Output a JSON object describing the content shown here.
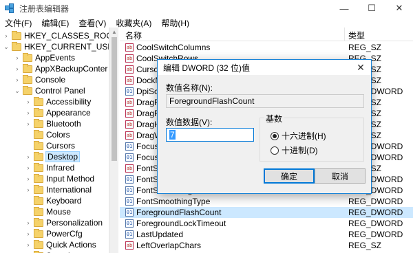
{
  "window": {
    "title": "注册表编辑器",
    "minimize": "—",
    "maximize": "☐",
    "close": "✕"
  },
  "menu": [
    "文件(F)",
    "编辑(E)",
    "查看(V)",
    "收藏夹(A)",
    "帮助(H)"
  ],
  "tree": [
    {
      "label": "HKEY_CLASSES_ROOT",
      "expander": "›",
      "indent": 0
    },
    {
      "label": "HKEY_CURRENT_USER",
      "expander": "⌄",
      "indent": 0
    },
    {
      "label": "AppEvents",
      "expander": "›",
      "indent": 1
    },
    {
      "label": "AppXBackupConter",
      "expander": "›",
      "indent": 1
    },
    {
      "label": "Console",
      "expander": "›",
      "indent": 1
    },
    {
      "label": "Control Panel",
      "expander": "⌄",
      "indent": 1
    },
    {
      "label": "Accessibility",
      "expander": "›",
      "indent": 2
    },
    {
      "label": "Appearance",
      "expander": "›",
      "indent": 2
    },
    {
      "label": "Bluetooth",
      "expander": "›",
      "indent": 2
    },
    {
      "label": "Colors",
      "expander": "",
      "indent": 2
    },
    {
      "label": "Cursors",
      "expander": "",
      "indent": 2
    },
    {
      "label": "Desktop",
      "expander": "›",
      "indent": 2,
      "selected": true
    },
    {
      "label": "Infrared",
      "expander": "›",
      "indent": 2
    },
    {
      "label": "Input Method",
      "expander": "›",
      "indent": 2
    },
    {
      "label": "International",
      "expander": "›",
      "indent": 2
    },
    {
      "label": "Keyboard",
      "expander": "",
      "indent": 2
    },
    {
      "label": "Mouse",
      "expander": "",
      "indent": 2
    },
    {
      "label": "Personalization",
      "expander": "›",
      "indent": 2
    },
    {
      "label": "PowerCfg",
      "expander": "›",
      "indent": 2
    },
    {
      "label": "Quick Actions",
      "expander": "›",
      "indent": 2
    },
    {
      "label": "Sound",
      "expander": "›",
      "indent": 2
    }
  ],
  "list": {
    "header_name": "名称",
    "header_type": "类型",
    "rows": [
      {
        "name": "CoolSwitchColumns",
        "type": "REG_SZ",
        "icon": "sz"
      },
      {
        "name": "CoolSwitchRows",
        "type": "REG_SZ",
        "icon": "sz"
      },
      {
        "name": "CursorBlinkRate",
        "type": "REG_SZ",
        "icon": "sz"
      },
      {
        "name": "DockMoving",
        "type": "REG_SZ",
        "icon": "sz"
      },
      {
        "name": "DpiScalingVer",
        "type": "REG_DWORD",
        "icon": "dw"
      },
      {
        "name": "DragFromMaximize",
        "type": "REG_SZ",
        "icon": "sz"
      },
      {
        "name": "DragFullWindows",
        "type": "REG_SZ",
        "icon": "sz"
      },
      {
        "name": "DragHeight",
        "type": "REG_SZ",
        "icon": "sz"
      },
      {
        "name": "DragWidth",
        "type": "REG_SZ",
        "icon": "sz"
      },
      {
        "name": "FocusBorderHeight",
        "type": "REG_DWORD",
        "icon": "dw"
      },
      {
        "name": "FocusBorderWidth",
        "type": "REG_DWORD",
        "icon": "dw"
      },
      {
        "name": "FontSmoothing",
        "type": "REG_SZ",
        "icon": "sz"
      },
      {
        "name": "FontSmoothingGamma",
        "type": "REG_DWORD",
        "icon": "dw"
      },
      {
        "name": "FontSmoothingOrientation",
        "type": "REG_DWORD",
        "icon": "dw"
      },
      {
        "name": "FontSmoothingType",
        "type": "REG_DWORD",
        "icon": "dw"
      },
      {
        "name": "ForegroundFlashCount",
        "type": "REG_DWORD",
        "icon": "dw",
        "selected": true
      },
      {
        "name": "ForegroundLockTimeout",
        "type": "REG_DWORD",
        "icon": "dw"
      },
      {
        "name": "LastUpdated",
        "type": "REG_DWORD",
        "icon": "dw"
      },
      {
        "name": "LeftOverlapChars",
        "type": "REG_SZ",
        "icon": "sz"
      }
    ]
  },
  "dialog": {
    "title": "编辑 DWORD (32 位)值",
    "close": "✕",
    "value_name_label": "数值名称(N):",
    "value_name": "ForegroundFlashCount",
    "value_data_label": "数值数据(V):",
    "value_data": "7",
    "base_label": "基数",
    "hex_label": "十六进制(H)",
    "dec_label": "十进制(D)",
    "hex_selected": true,
    "ok": "确定",
    "cancel": "取消"
  }
}
